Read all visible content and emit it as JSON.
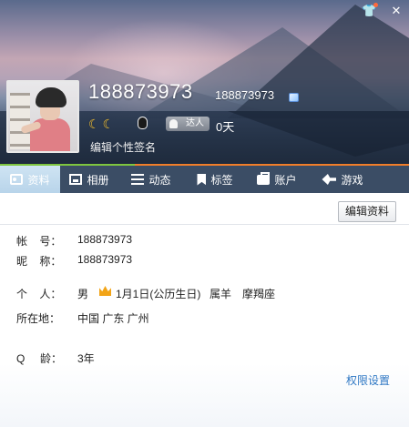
{
  "header": {
    "nickname": "188873973",
    "qq_number": "188873973",
    "days": "0天",
    "daren_label": "达人",
    "signature_placeholder": "编辑个性签名",
    "level_icons": [
      "moon-icon",
      "moon-icon"
    ],
    "top_buttons": [
      "skin-icon",
      "close-icon"
    ]
  },
  "tabs": [
    {
      "label": "资料",
      "icon": "profile-card-icon",
      "active": true
    },
    {
      "label": "相册",
      "icon": "photo-icon",
      "active": false
    },
    {
      "label": "动态",
      "icon": "feed-list-icon",
      "active": false
    },
    {
      "label": "标签",
      "icon": "bookmark-tag-icon",
      "active": false
    },
    {
      "label": "账户",
      "icon": "wallet-icon",
      "active": false
    },
    {
      "label": "游戏",
      "icon": "game-icon",
      "active": false
    }
  ],
  "profile": {
    "edit_button": "编辑资料",
    "account": {
      "label": "帐    号：",
      "value": "188873973"
    },
    "nickname": {
      "label": "昵    称：",
      "value": "188873973"
    },
    "person": {
      "label": "个    人：",
      "gender": "男",
      "birthday": "1月1日(公历生日)",
      "zodiac": "属羊",
      "constellation": "摩羯座"
    },
    "location": {
      "label": "所在地：",
      "value": "中国 广东 广州"
    },
    "qage": {
      "label": "Q     龄：",
      "value": "3年"
    },
    "permission_link": "权限设置"
  },
  "colors": {
    "tab_bar": "#3b4d65",
    "tab_accent": "#f07e2a",
    "link": "#2f78c4"
  }
}
